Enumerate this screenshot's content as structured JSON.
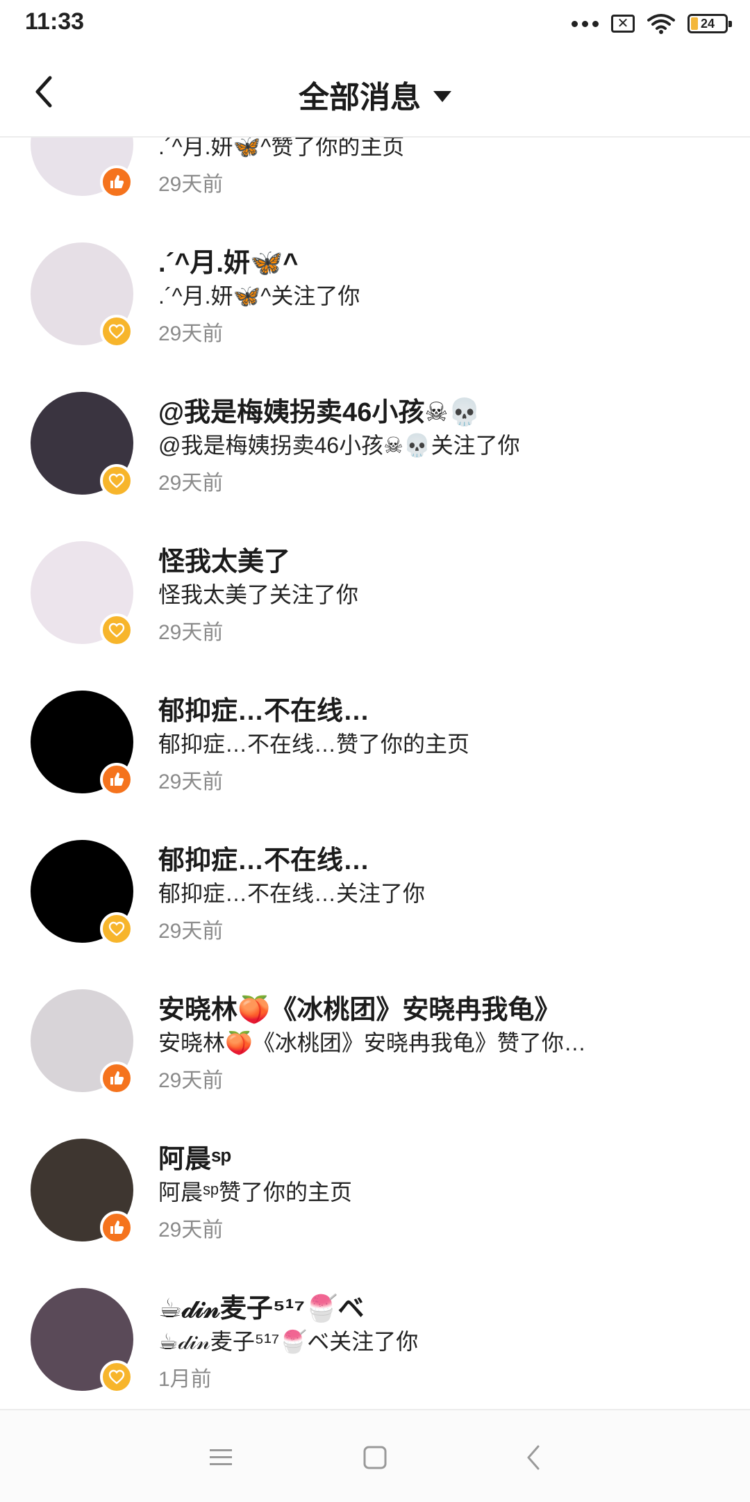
{
  "status": {
    "time": "11:33",
    "sim": "✕",
    "battery": "24"
  },
  "header": {
    "title": "全部消息"
  },
  "items": [
    {
      "name": "",
      "desc": ".´^月.妍🦋^赞了你的主页",
      "time": "29天前",
      "type": "like",
      "avatar_color": "#e8e2ea"
    },
    {
      "name": ".´^月.妍🦋^",
      "desc": ".´^月.妍🦋^关注了你",
      "time": "29天前",
      "type": "follow",
      "avatar_color": "#e6dfe6"
    },
    {
      "name": "@我是梅姨拐卖46小孩☠💀",
      "desc": "@我是梅姨拐卖46小孩☠💀关注了你",
      "time": "29天前",
      "type": "follow",
      "avatar_color": "#3a3440"
    },
    {
      "name": "怪我太美了",
      "desc": "怪我太美了关注了你",
      "time": "29天前",
      "type": "follow",
      "avatar_color": "#ece4ec"
    },
    {
      "name": "郁抑症…不在线…",
      "desc": "郁抑症…不在线…赞了你的主页",
      "time": "29天前",
      "type": "like",
      "avatar_color": "#000000"
    },
    {
      "name": "郁抑症…不在线…",
      "desc": "郁抑症…不在线…关注了你",
      "time": "29天前",
      "type": "follow",
      "avatar_color": "#000000"
    },
    {
      "name": "安晓林🍑《冰桃团》安晓冉我龟》",
      "desc": "安晓林🍑《冰桃团》安晓冉我龟》赞了你…",
      "time": "29天前",
      "type": "like",
      "avatar_color": "#d8d4d8"
    },
    {
      "name": "阿晨ˢᵖ",
      "desc": "阿晨ˢᵖ赞了你的主页",
      "time": "29天前",
      "type": "like",
      "avatar_color": "#3e3630"
    },
    {
      "name": "☕𝒹𝒾𝓃麦子⁵¹⁷🍧ベ",
      "desc": "☕𝒹𝒾𝓃麦子⁵¹⁷🍧ベ关注了你",
      "time": "1月前",
      "type": "follow",
      "avatar_color": "#5a4a58"
    }
  ],
  "colors": {
    "like": "#f5731d",
    "follow": "#f7b52b"
  },
  "icons": {
    "like": "thumbs-up-icon",
    "follow": "heart-icon"
  }
}
